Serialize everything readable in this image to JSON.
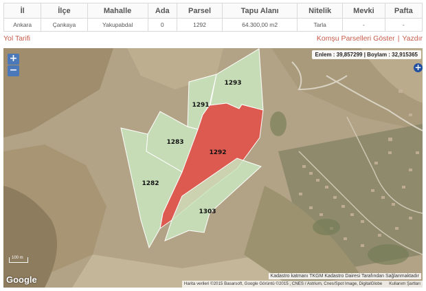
{
  "table": {
    "headers": [
      "İl",
      "İlçe",
      "Mahalle",
      "Ada",
      "Parsel",
      "Tapu Alanı",
      "Nitelik",
      "Mevki",
      "Pafta"
    ],
    "row": [
      "Ankara",
      "Çankaya",
      "Yakupabdal",
      "0",
      "1292",
      "64.300,00 m2",
      "Tarla",
      "-",
      "-"
    ]
  },
  "links": {
    "route": "Yol Tarifi",
    "neighbors": "Komşu Parselleri Göster",
    "separator": "|",
    "print": "Yazdır"
  },
  "map": {
    "zoom_in": "+",
    "zoom_out": "−",
    "coords": "Enlem : 39,857299 | Boylam : 32,915365",
    "plus_badge": "+",
    "scale_label": "100 m",
    "google": "Google",
    "notice": "Kadastro katmanı TKGM Kadastro Dairesi Tarafından Sağlanmaktadır",
    "attribution": "Harita verileri ©2015 Basarsoft, Google Görüntü ©2015 , CNES / Astrium, Cnes/Spot Image, DigitalGlobe",
    "terms": "Kullanım Şartları",
    "parcels": [
      {
        "id": "1293",
        "selected": false
      },
      {
        "id": "1291",
        "selected": false
      },
      {
        "id": "1283",
        "selected": false
      },
      {
        "id": "1292",
        "selected": true
      },
      {
        "id": "1282",
        "selected": false
      },
      {
        "id": "1303",
        "selected": false
      }
    ],
    "colors": {
      "selected_fill": "#e0544c",
      "neighbor_fill": "#c9e6c0",
      "outline": "#ffffff"
    }
  }
}
